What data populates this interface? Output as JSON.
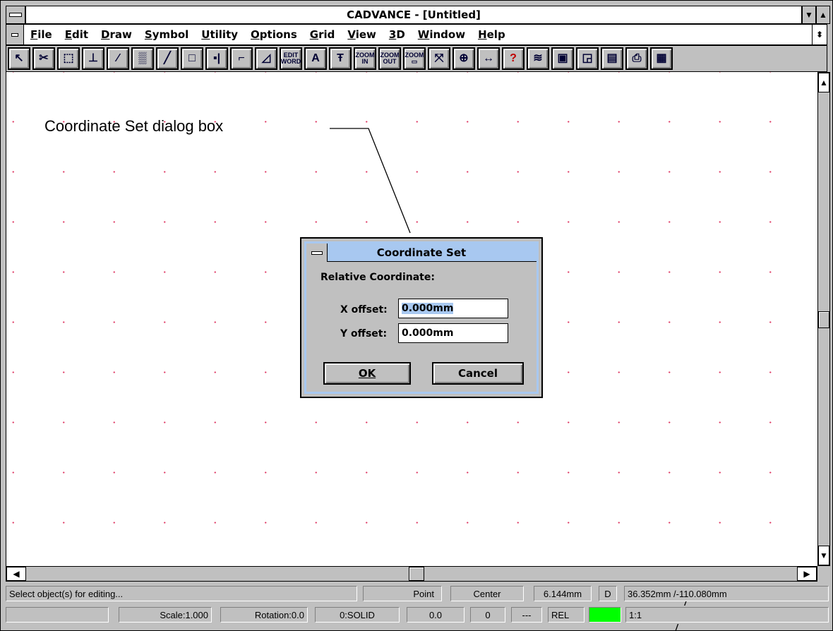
{
  "window": {
    "title": "CADVANCE - [Untitled]"
  },
  "menu": [
    "File",
    "Edit",
    "Draw",
    "Symbol",
    "Utility",
    "Options",
    "Grid",
    "View",
    "3D",
    "Window",
    "Help"
  ],
  "toolbar": {
    "tools": [
      {
        "name": "select-pointer-icon",
        "glyph": "↖"
      },
      {
        "name": "cut-scissors-icon",
        "glyph": "✂"
      },
      {
        "name": "move-icon",
        "glyph": "⬚"
      },
      {
        "name": "stretch-icon",
        "glyph": "⊥"
      },
      {
        "name": "trim-icon",
        "glyph": "⁄"
      },
      {
        "name": "hatch-icon",
        "glyph": "▒"
      },
      {
        "name": "line-icon",
        "glyph": "╱"
      },
      {
        "name": "rectangle-icon",
        "glyph": "□"
      },
      {
        "name": "dimension-icon",
        "glyph": "▪|"
      },
      {
        "name": "polyline-icon",
        "glyph": "⌐"
      },
      {
        "name": "angle-dimension-icon",
        "glyph": "◿"
      },
      {
        "name": "edit-word-icon",
        "glyph": "EDIT WORD"
      },
      {
        "name": "text-icon",
        "glyph": "A"
      },
      {
        "name": "text-style-icon",
        "glyph": "Ŧ"
      },
      {
        "name": "zoom-in-icon",
        "glyph": "ZOOM IN"
      },
      {
        "name": "zoom-out-icon",
        "glyph": "ZOOM OUT"
      },
      {
        "name": "zoom-window-icon",
        "glyph": "ZOOM ▭"
      },
      {
        "name": "zoom-extents-icon",
        "glyph": "⤧"
      },
      {
        "name": "snap-crosshair-icon",
        "glyph": "⊕"
      },
      {
        "name": "query-distance-icon",
        "glyph": "↔"
      },
      {
        "name": "help-icon",
        "glyph": "?"
      },
      {
        "name": "layers-icon",
        "glyph": "≋"
      },
      {
        "name": "camera-view-icon",
        "glyph": "▣"
      },
      {
        "name": "3d-view-icon",
        "glyph": "◲"
      },
      {
        "name": "document-icon",
        "glyph": "▤"
      },
      {
        "name": "print-icon",
        "glyph": "⎙"
      },
      {
        "name": "calculator-icon",
        "glyph": "▦"
      }
    ]
  },
  "annotation": {
    "text": "Coordinate Set dialog box"
  },
  "dialog": {
    "title": "Coordinate Set",
    "section_label": "Relative Coordinate:",
    "x_label": "X offset:",
    "x_value": "0.000mm",
    "y_label": "Y offset:",
    "y_value": "0.000mm",
    "ok_label": "OK",
    "cancel_label": "Cancel"
  },
  "status": {
    "message": "Select object(s) for editing...",
    "snap_mode": "Point",
    "snap_origin": "Center",
    "distance": "6.144mm",
    "distance_flag": "D",
    "coordinates": "36.352mm /-110.080mm",
    "scale": "Scale:1.000",
    "rotation": "Rotation:0.0",
    "linetype": "0:SOLID",
    "line_width": "0.0",
    "layer": "0",
    "pen": "---",
    "coord_mode": "REL",
    "ratio": "1:1",
    "layer_color": "#00ff00"
  }
}
